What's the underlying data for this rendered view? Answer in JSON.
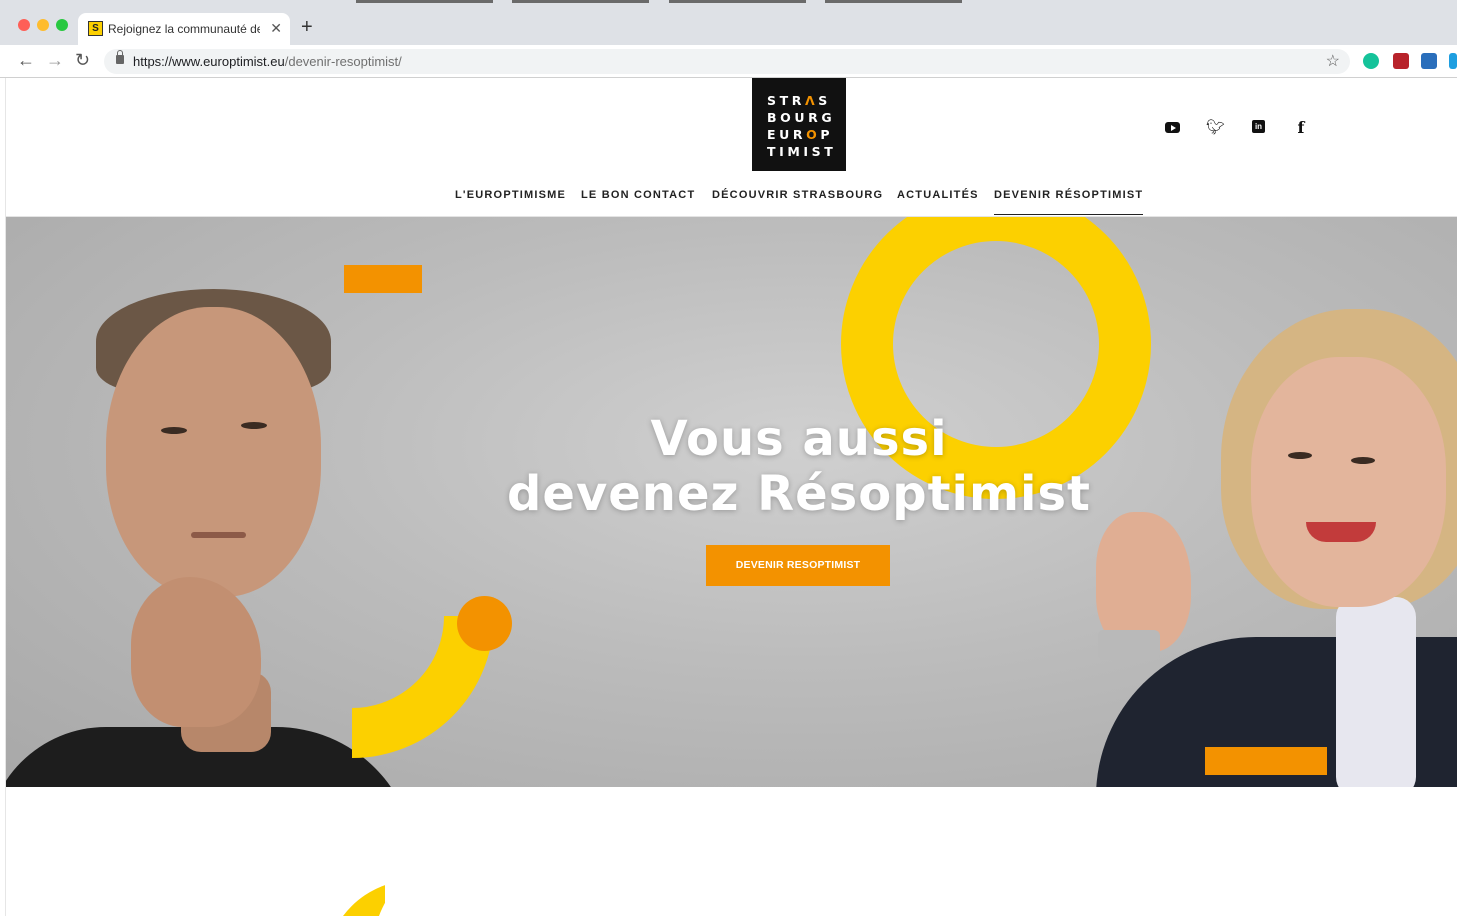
{
  "browser": {
    "tab_title": "Rejoignez la communauté des R",
    "tab_favicon_letter": "S",
    "url_host": "https://www.europtimist.eu",
    "url_path": "/devenir-resoptimist/"
  },
  "logo": {
    "lines": [
      "STRAS",
      "BOURG",
      "EUROP",
      "TIMIST"
    ]
  },
  "nav": {
    "items": [
      "L'EUROPTIMISME",
      "LE BON CONTACT",
      "DÉCOUVRIR STRASBOURG",
      "ACTUALITÉS",
      "DEVENIR RÉSOPTIMIST"
    ],
    "active": "DEVENIR RÉSOPTIMIST"
  },
  "social": {
    "icons": [
      "youtube-icon",
      "twitter-icon",
      "linkedin-icon",
      "facebook-icon"
    ]
  },
  "hero": {
    "title_line1": "Vous aussi",
    "title_line2": "devenez Résoptimist",
    "cta_label": "DEVENIR RESOPTIMIST"
  },
  "colors": {
    "brand_yellow": "#fcd000",
    "brand_orange": "#f39200",
    "logo_bg": "#111111"
  }
}
